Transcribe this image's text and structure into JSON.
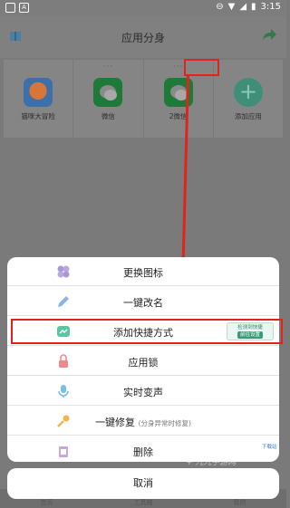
{
  "status_bar": {
    "time": "3:15",
    "notif_a": "A"
  },
  "app_bar": {
    "title": "应用分身"
  },
  "apps": [
    {
      "label": "猫咪大冒险",
      "more": ""
    },
    {
      "label": "微信",
      "more": "···"
    },
    {
      "label": "2微信",
      "more": "···"
    },
    {
      "label": "添加应用",
      "more": ""
    }
  ],
  "sheet": {
    "items": [
      {
        "label": "更换图标",
        "icon": "flower-icon"
      },
      {
        "label": "一键改名",
        "icon": "pencil-icon"
      },
      {
        "label": "添加快捷方式",
        "icon": "shortcut-icon"
      },
      {
        "label": "应用锁",
        "icon": "lock-icon"
      },
      {
        "label": "实时变声",
        "icon": "mic-icon"
      },
      {
        "label": "一键修复",
        "sub": "(分身异常时修复)",
        "icon": "wrench-icon"
      },
      {
        "label": "删除",
        "icon": "trash-icon"
      }
    ],
    "tag_line1": "检测到快捷",
    "tag_line2": "前往设置",
    "fast_download": "下载站",
    "cancel": "取消"
  },
  "watermark": "+ 九九手游网",
  "bottom_nav": [
    "首页",
    "工具箱",
    "我的"
  ],
  "colors": {
    "accent_red": "#e0231c",
    "shortcut_green": "#3a9a78"
  }
}
